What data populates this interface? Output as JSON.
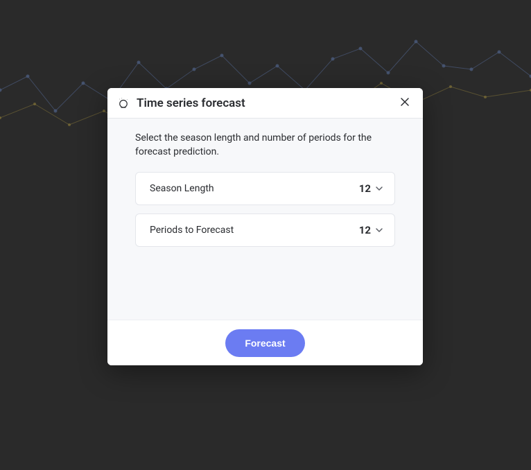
{
  "modal": {
    "title": "Time series forecast",
    "description": "Select the season length and number of periods for the forecast prediction.",
    "fields": {
      "season_length": {
        "label": "Season Length",
        "value": "12"
      },
      "periods": {
        "label": "Periods to Forecast",
        "value": "12"
      }
    },
    "submit_label": "Forecast"
  }
}
